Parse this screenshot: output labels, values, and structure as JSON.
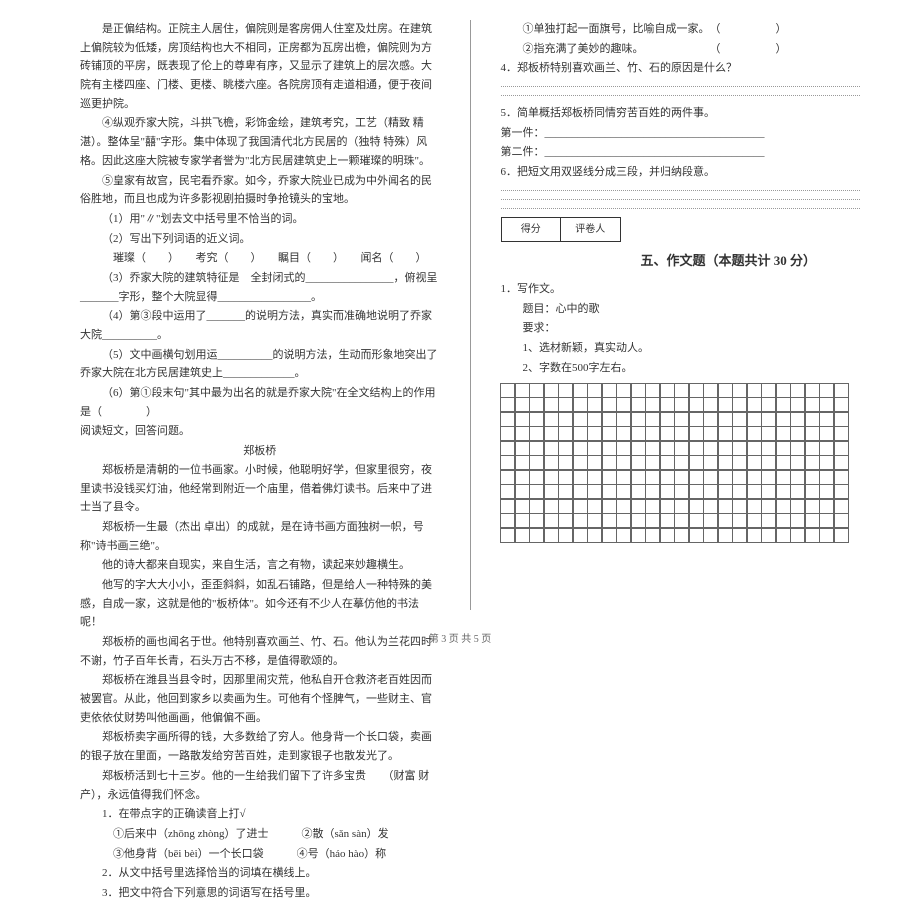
{
  "footer": "第 3 页  共 5 页",
  "left": {
    "p1": "是正偏结构。正院主人居住，偏院则是客房佣人住室及灶房。在建筑上偏院较为低矮，房顶结构也大不相同，正房都为瓦房出檐，偏院则为方砖铺顶的平房，既表现了伦上的尊卑有序，又显示了建筑上的层次感。大院有主楼四座、门楼、更楼、眺楼六座。各院房顶有走道相通，便于夜间巡更护院。",
    "p2": "④纵观乔家大院，斗拱飞檐，彩饰金绘，建筑考究，工艺（精致  精湛）。整体呈\"囍\"字形。集中体现了我国清代北方民居的（独特  特殊）风格。因此这座大院被专家学者誉为\"北方民居建筑史上一颗璀璨的明珠\"。",
    "p3": "⑤皇家有故宫，民宅看乔家。如今，乔家大院业已成为中外闻名的民俗胜地，而且也成为许多影视剧拍摄时争抢镜头的宝地。",
    "q1": "（1）用\"∥\"划去文中括号里不恰当的词。",
    "q2": "（2）写出下列词语的近义词。",
    "q2_words": "璀璨（　　）　　考究（　　）　　瞩目（　　）　　闻名（　　）",
    "q3": "（3）乔家大院的建筑特征是　全封闭式的________________，俯视呈_______字形，整个大院显得_________________。",
    "q4": "（4）第③段中运用了_______的说明方法，真实而准确地说明了乔家大院__________。",
    "q5": "（5）文中画横句划用运__________的说明方法，生动而形象地突出了乔家大院在北方民居建筑史上_____________。",
    "q6": "（6）第①段末句\"其中最为出名的就是乔家大院\"在全文结构上的作用是（　　　　）",
    "read_intro": "阅读短文，回答问题。",
    "title": "郑板桥",
    "r1": "郑板桥是清朝的一位书画家。小时候，他聪明好学，但家里很穷，夜里读书没钱买灯油，他经常到附近一个庙里，借着佛灯读书。后来中了进士当了县令。",
    "r2": "郑板桥一生最（杰出  卓出）的成就，是在诗书画方面独树一帜，号称\"诗书画三绝\"。",
    "r3": "他的诗大都来自现实，来自生活，言之有物，读起来妙趣横生。",
    "r4": "他写的字大大小小，歪歪斜斜，如乱石铺路，但是给人一种特殊的美感，自成一家，这就是他的\"板桥体\"。如今还有不少人在摹仿他的书法呢！",
    "r5": "郑板桥的画也闻名于世。他特别喜欢画兰、竹、石。他认为兰花四时不谢，竹子百年长青，石头万古不移，是值得歌颂的。",
    "r6": "郑板桥在潍县当县令时，因那里闹灾荒，他私自开仓救济老百姓因而被罢官。从此，他回到家乡以卖画为生。可他有个怪脾气，一些财主、官吏依依仗财势叫他画画，他偏偏不画。",
    "r7": "郑板桥卖字画所得的钱，大多数给了穷人。他身背一个长口袋，卖画的银子放在里面，一路散发给穷苦百姓，走到家银子也散发光了。",
    "r8": "郑板桥活到七十三岁。他的一生给我们留下了许多宝贵　　（财富 财产），永远值得我们怀念。",
    "qq1": "1．在带点字的正确读音上打√",
    "qq1a": "①后来中（zhōng zhòng）了进士　　　②散（sǎn sàn）发",
    "qq1b": "③他身背（bēi bèi）一个长口袋　　　④号（háo hào）称",
    "qq2": "2．从文中括号里选择恰当的词填在横线上。",
    "qq3": "3．把文中符合下列意思的词语写在括号里。"
  },
  "right": {
    "q3a": "①单独打起一面旗号，比喻自成一家。　（　　　　　）",
    "q3b": "②指充满了美妙的趣味。　　　　　　　（　　　　　）",
    "q4": "4．郑板桥特别喜欢画兰、竹、石的原因是什么？",
    "q5": "5．简单概括郑板桥同情穷苦百姓的两件事。",
    "q5a": "第一件：________________________________________",
    "q5b": "第二件：________________________________________",
    "q6": "6．把短文用双竖线分成三段，并归纳段意。",
    "score1": "得分",
    "score2": "评卷人",
    "section": "五、作文题（本题共计 30 分）",
    "essay1": "1．写作文。",
    "essay_topic": "题目：心中的歌",
    "essay_req": "要求：",
    "essay_req1": "1、选材新颖，真实动人。",
    "essay_req2": "2、字数在500字左右。"
  }
}
